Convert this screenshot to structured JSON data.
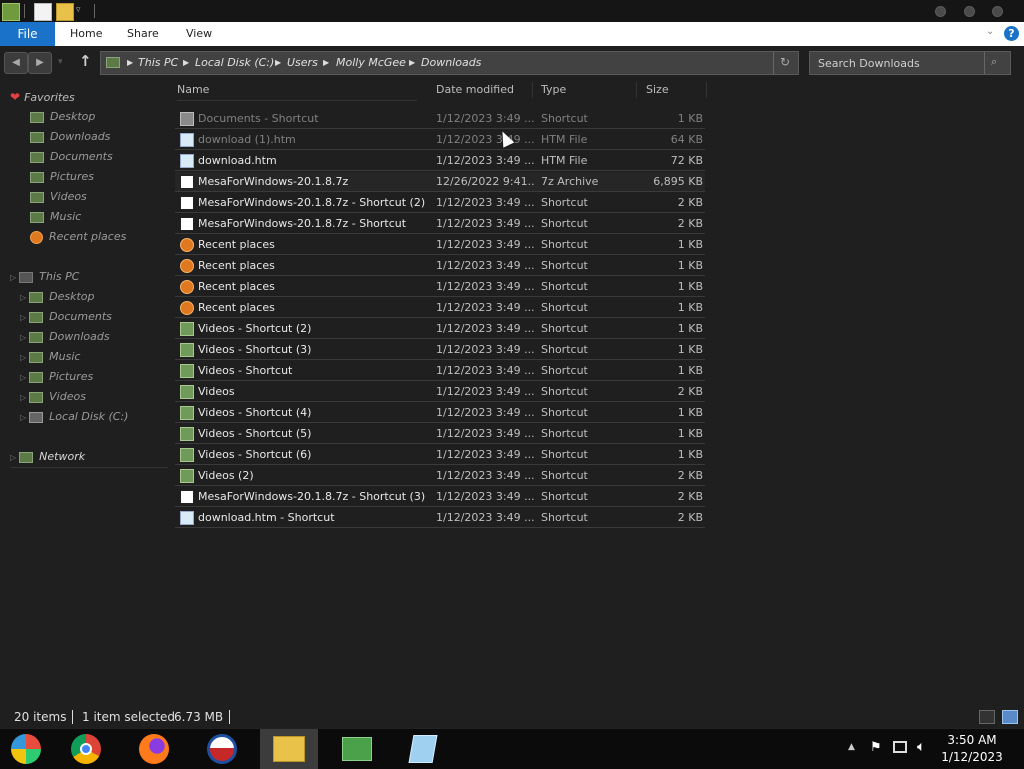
{
  "ribbon": {
    "file_label": "File",
    "tabs": [
      "Home",
      "Share",
      "View"
    ]
  },
  "address": {
    "crumbs": [
      "This PC",
      "Local Disk (C:)",
      "Users",
      "Molly McGee",
      "Downloads"
    ]
  },
  "search": {
    "placeholder": "Search Downloads"
  },
  "nav": {
    "favorites_label": "Favorites",
    "favorites": [
      "Desktop",
      "Downloads",
      "Documents",
      "Pictures",
      "Videos",
      "Music",
      "Recent places"
    ],
    "thispc_label": "This PC",
    "thispc": [
      "Desktop",
      "Documents",
      "Downloads",
      "Music",
      "Pictures",
      "Videos",
      "Local Disk (C:)"
    ],
    "network_label": "Network"
  },
  "columns": {
    "name": "Name",
    "date": "Date modified",
    "type": "Type",
    "size": "Size"
  },
  "files": [
    {
      "name": "Documents - Shortcut",
      "date": "1/12/2023 3:49 ...",
      "type": "Shortcut",
      "size": "1 KB",
      "icon": "folder-shortcut-icon"
    },
    {
      "name": "download (1).htm",
      "date": "1/12/2023 3:49 ...",
      "type": "HTM File",
      "size": "64 KB",
      "icon": "htm-file-icon"
    },
    {
      "name": "download.htm",
      "date": "1/12/2023 3:49 ...",
      "type": "HTM File",
      "size": "72 KB",
      "icon": "htm-file-icon"
    },
    {
      "name": "MesaForWindows-20.1.8.7z",
      "date": "12/26/2022 9:41...",
      "type": "7z Archive",
      "size": "6,895 KB",
      "icon": "7z-archive-icon"
    },
    {
      "name": "MesaForWindows-20.1.8.7z - Shortcut (2)",
      "date": "1/12/2023 3:49 ...",
      "type": "Shortcut",
      "size": "2 KB",
      "icon": "7z-archive-icon"
    },
    {
      "name": "MesaForWindows-20.1.8.7z - Shortcut",
      "date": "1/12/2023 3:49 ...",
      "type": "Shortcut",
      "size": "2 KB",
      "icon": "7z-archive-icon"
    },
    {
      "name": "Recent places",
      "date": "1/12/2023 3:49 ...",
      "type": "Shortcut",
      "size": "1 KB",
      "icon": "recent-places-icon"
    },
    {
      "name": "Recent places",
      "date": "1/12/2023 3:49 ...",
      "type": "Shortcut",
      "size": "1 KB",
      "icon": "recent-places-icon"
    },
    {
      "name": "Recent places",
      "date": "1/12/2023 3:49 ...",
      "type": "Shortcut",
      "size": "1 KB",
      "icon": "recent-places-icon"
    },
    {
      "name": "Recent places",
      "date": "1/12/2023 3:49 ...",
      "type": "Shortcut",
      "size": "1 KB",
      "icon": "recent-places-icon"
    },
    {
      "name": "Videos - Shortcut (2)",
      "date": "1/12/2023 3:49 ...",
      "type": "Shortcut",
      "size": "1 KB",
      "icon": "videos-folder-icon"
    },
    {
      "name": "Videos - Shortcut (3)",
      "date": "1/12/2023 3:49 ...",
      "type": "Shortcut",
      "size": "1 KB",
      "icon": "videos-folder-icon"
    },
    {
      "name": "Videos - Shortcut",
      "date": "1/12/2023 3:49 ...",
      "type": "Shortcut",
      "size": "1 KB",
      "icon": "videos-folder-icon"
    },
    {
      "name": "Videos",
      "date": "1/12/2023 3:49 ...",
      "type": "Shortcut",
      "size": "2 KB",
      "icon": "videos-folder-icon"
    },
    {
      "name": "Videos - Shortcut (4)",
      "date": "1/12/2023 3:49 ...",
      "type": "Shortcut",
      "size": "1 KB",
      "icon": "videos-folder-icon"
    },
    {
      "name": "Videos - Shortcut (5)",
      "date": "1/12/2023 3:49 ...",
      "type": "Shortcut",
      "size": "1 KB",
      "icon": "videos-folder-icon"
    },
    {
      "name": "Videos - Shortcut (6)",
      "date": "1/12/2023 3:49 ...",
      "type": "Shortcut",
      "size": "1 KB",
      "icon": "videos-folder-icon"
    },
    {
      "name": "Videos (2)",
      "date": "1/12/2023 3:49 ...",
      "type": "Shortcut",
      "size": "2 KB",
      "icon": "videos-folder-icon"
    },
    {
      "name": "MesaForWindows-20.1.8.7z - Shortcut (3)",
      "date": "1/12/2023 3:49 ...",
      "type": "Shortcut",
      "size": "2 KB",
      "icon": "7z-archive-icon"
    },
    {
      "name": "download.htm - Shortcut",
      "date": "1/12/2023 3:49 ...",
      "type": "Shortcut",
      "size": "2 KB",
      "icon": "htm-file-icon"
    }
  ],
  "status": {
    "items": "20 items",
    "selected": "1 item selected",
    "selected_size": "6.73 MB"
  },
  "taskbar": {
    "apps": [
      "start-orb-icon",
      "chrome-icon",
      "firefox-icon",
      "obama-logo-icon",
      "file-explorer-icon",
      "control-panel-icon",
      "notepad-icon"
    ],
    "time": "3:50 AM",
    "date": "1/12/2023"
  },
  "colors": {
    "accent": "#1a73c9",
    "background": "#1f1f1f",
    "taskbar": "#0b0b0b"
  }
}
